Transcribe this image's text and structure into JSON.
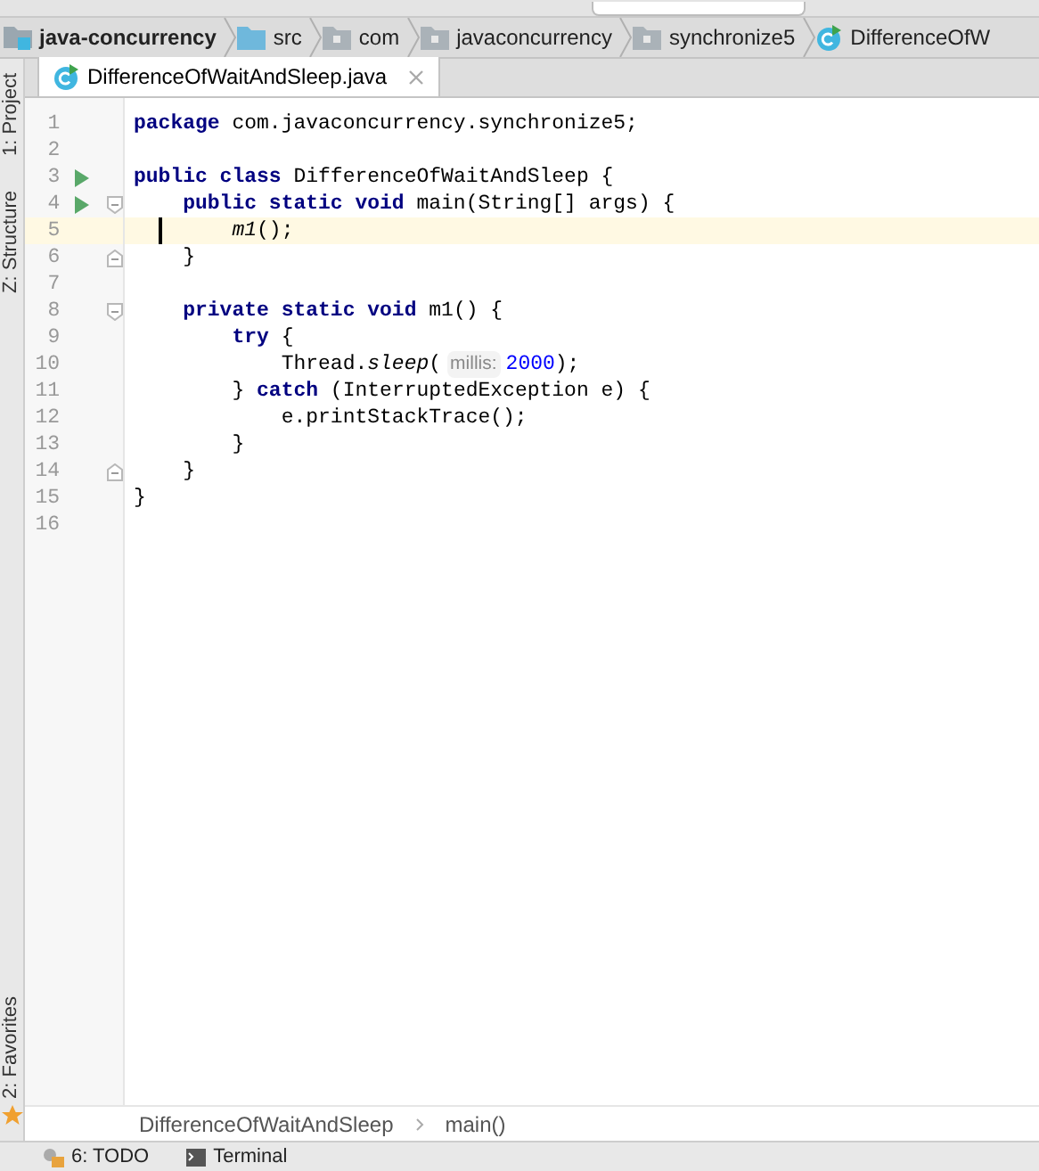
{
  "breadcrumbs": [
    {
      "label": "java-concurrency",
      "kind": "project"
    },
    {
      "label": "src",
      "kind": "source"
    },
    {
      "label": "com",
      "kind": "package"
    },
    {
      "label": "javaconcurrency",
      "kind": "package"
    },
    {
      "label": "synchronize5",
      "kind": "package"
    },
    {
      "label": "DifferenceOfW",
      "kind": "class"
    }
  ],
  "left_tools": [
    {
      "label": "1: Project"
    },
    {
      "label": "Z: Structure"
    }
  ],
  "left_tools_bottom": [
    {
      "label": "2: Favorites"
    }
  ],
  "tabs": [
    {
      "label": "DifferenceOfWaitAndSleep.java",
      "selected": true
    }
  ],
  "lines": [
    {
      "number": "1",
      "run": false,
      "fold_start": false,
      "fold_end": false,
      "current": false,
      "tokens": [
        {
          "text": "package",
          "kind": "keyword"
        },
        {
          "text": " com.javaconcurrency.synchronize5;",
          "kind": "plain"
        }
      ]
    },
    {
      "number": "2",
      "run": false,
      "fold_start": false,
      "fold_end": false,
      "current": false
    },
    {
      "number": "3",
      "run": true,
      "fold_start": false,
      "fold_end": false,
      "current": false,
      "tokens": [
        {
          "text": "public class",
          "kind": "keyword"
        },
        {
          "text": " DifferenceOfWaitAndSleep {",
          "kind": "plain"
        }
      ]
    },
    {
      "number": "4",
      "run": true,
      "fold_start": true,
      "fold_end": false,
      "current": false,
      "tokens": [
        {
          "text": "    public static void",
          "kind": "keyword"
        },
        {
          "text": " main(String[] args) {",
          "kind": "plain"
        }
      ]
    },
    {
      "number": "5",
      "run": false,
      "fold_start": false,
      "fold_end": false,
      "current": true,
      "tokens": [
        {
          "text": "        m1",
          "kind": "italic"
        },
        {
          "text": "();",
          "kind": "plain"
        }
      ]
    },
    {
      "number": "6",
      "run": false,
      "fold_start": false,
      "fold_end": true,
      "current": false,
      "tokens": [
        {
          "text": "    }",
          "kind": "plain"
        }
      ]
    },
    {
      "number": "7",
      "run": false,
      "fold_start": false,
      "fold_end": false,
      "current": false
    },
    {
      "number": "8",
      "run": false,
      "fold_start": true,
      "fold_end": false,
      "current": false,
      "tokens": [
        {
          "text": "    private static void",
          "kind": "keyword"
        },
        {
          "text": " m1() {",
          "kind": "plain"
        }
      ]
    },
    {
      "number": "9",
      "run": false,
      "fold_start": false,
      "fold_end": false,
      "current": false,
      "tokens": [
        {
          "text": "        try",
          "kind": "keyword"
        },
        {
          "text": " {",
          "kind": "plain"
        }
      ]
    },
    {
      "number": "10",
      "run": false,
      "fold_start": false,
      "fold_end": false,
      "current": false,
      "tokens": [
        {
          "text": "            Thread.",
          "kind": "plain"
        },
        {
          "text": "sleep",
          "kind": "italic"
        },
        {
          "text": "(",
          "kind": "plain"
        },
        {
          "text": "millis:",
          "kind": "hint"
        },
        {
          "text": "2000",
          "kind": "number"
        },
        {
          "text": ");",
          "kind": "plain"
        }
      ]
    },
    {
      "number": "11",
      "run": false,
      "fold_start": false,
      "fold_end": false,
      "current": false,
      "tokens": [
        {
          "text": "        } ",
          "kind": "plain"
        },
        {
          "text": "catch",
          "kind": "keyword"
        },
        {
          "text": " (InterruptedException e) {",
          "kind": "plain"
        }
      ]
    },
    {
      "number": "12",
      "run": false,
      "fold_start": false,
      "fold_end": false,
      "current": false,
      "tokens": [
        {
          "text": "            e.printStackTrace();",
          "kind": "plain"
        }
      ]
    },
    {
      "number": "13",
      "run": false,
      "fold_start": false,
      "fold_end": false,
      "current": false,
      "tokens": [
        {
          "text": "        }",
          "kind": "plain"
        }
      ]
    },
    {
      "number": "14",
      "run": false,
      "fold_start": false,
      "fold_end": true,
      "current": false,
      "tokens": [
        {
          "text": "    }",
          "kind": "plain"
        }
      ]
    },
    {
      "number": "15",
      "run": false,
      "fold_start": false,
      "fold_end": false,
      "current": false,
      "tokens": [
        {
          "text": "}",
          "kind": "plain"
        }
      ]
    },
    {
      "number": "16",
      "run": false,
      "fold_start": false,
      "fold_end": false,
      "current": false
    }
  ],
  "editor_breadcrumbs": [
    "DifferenceOfWaitAndSleep",
    "main()"
  ],
  "bottom_tools": [
    {
      "label": "6: TODO",
      "kind": "todo"
    },
    {
      "label": "Terminal",
      "kind": "terminal"
    }
  ]
}
